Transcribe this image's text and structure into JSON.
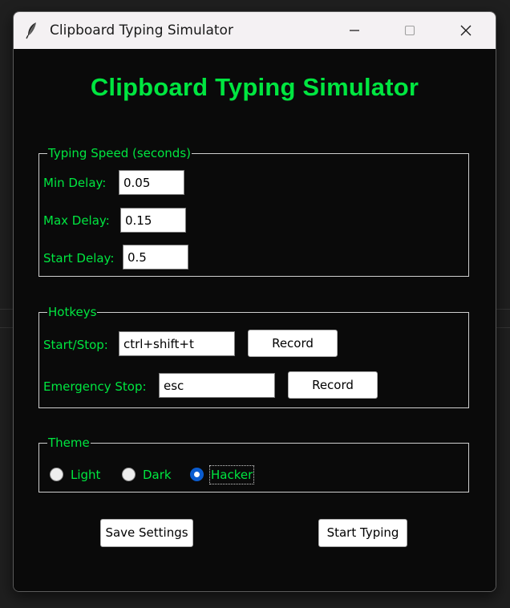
{
  "window": {
    "title": "Clipboard Typing Simulator",
    "icons": {
      "app": "feather-icon",
      "minimize": "minimize-icon",
      "maximize": "maximize-icon",
      "close": "close-icon"
    }
  },
  "app": {
    "heading": "Clipboard Typing Simulator",
    "accent_color": "#00e640",
    "background_color": "#0a0a0a"
  },
  "typing_speed": {
    "legend": "Typing Speed (seconds)",
    "min_delay": {
      "label": "Min Delay:",
      "value": "0.05"
    },
    "max_delay": {
      "label": "Max Delay:",
      "value": "0.15"
    },
    "start_delay": {
      "label": "Start Delay:",
      "value": "0.5"
    }
  },
  "hotkeys": {
    "legend": "Hotkeys",
    "start_stop": {
      "label": "Start/Stop:",
      "value": "ctrl+shift+t",
      "record_label": "Record"
    },
    "emergency_stop": {
      "label": "Emergency Stop:",
      "value": "esc",
      "record_label": "Record"
    }
  },
  "theme": {
    "legend": "Theme",
    "options": [
      "Light",
      "Dark",
      "Hacker"
    ],
    "selected": "Hacker"
  },
  "actions": {
    "save_label": "Save Settings",
    "start_label": "Start Typing"
  }
}
